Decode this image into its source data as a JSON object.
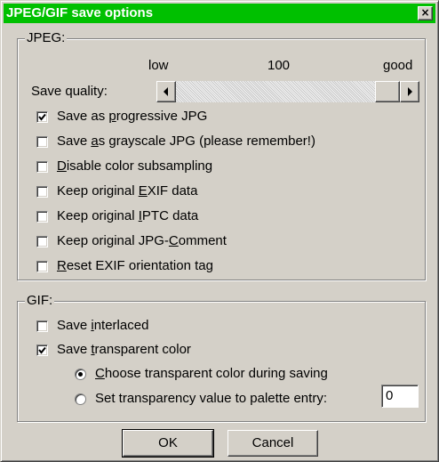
{
  "window": {
    "title": "JPEG/GIF save options",
    "close_glyph": "×"
  },
  "jpeg": {
    "legend": "JPEG:",
    "quality": {
      "label": "Save quality:",
      "low_label": "low",
      "value_label": "100",
      "high_label": "good",
      "value": 100,
      "min": 0,
      "max": 100
    },
    "options": [
      {
        "pre": "Save as ",
        "key": "p",
        "post": "rogressive JPG",
        "checked": true
      },
      {
        "pre": "Save ",
        "key": "a",
        "post": "s grayscale JPG (please remember!)",
        "checked": false
      },
      {
        "pre": "",
        "key": "D",
        "post": "isable color subsampling",
        "checked": false
      },
      {
        "pre": "Keep original ",
        "key": "E",
        "post": "XIF data",
        "checked": false
      },
      {
        "pre": "Keep original ",
        "key": "I",
        "post": "PTC data",
        "checked": false
      },
      {
        "pre": "Keep original JPG-",
        "key": "C",
        "post": "omment",
        "checked": false
      },
      {
        "pre": "",
        "key": "R",
        "post": "eset EXIF orientation tag",
        "checked": false
      }
    ]
  },
  "gif": {
    "legend": "GIF:",
    "interlaced": {
      "pre": "Save ",
      "key": "i",
      "post": "nterlaced",
      "checked": false
    },
    "transparent": {
      "pre": "Save ",
      "key": "t",
      "post": "ransparent color",
      "checked": true
    },
    "radios": [
      {
        "pre": "",
        "key": "C",
        "post": "hoose transparent color during saving",
        "selected": true
      },
      {
        "pre": "Set transparency value to palette entry:",
        "key": "",
        "post": "",
        "selected": false
      }
    ],
    "palette_entry_value": "0"
  },
  "buttons": {
    "ok": "OK",
    "cancel": "Cancel"
  },
  "icons": {
    "scroll_left": "left-arrow-icon",
    "scroll_right": "right-arrow-icon",
    "check": "check-mark-icon"
  }
}
